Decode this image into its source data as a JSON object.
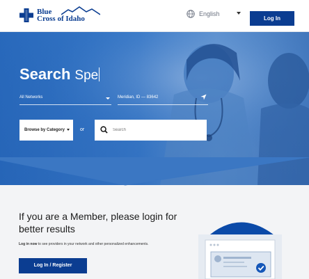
{
  "header": {
    "logo_line1": "Blue",
    "logo_line2": "Cross of Idaho",
    "language": "English",
    "login_label": "Log In"
  },
  "hero": {
    "title": "Search",
    "typed_text": "Spe",
    "network_select": "All Networks",
    "location_value": "Meridian, ID — 83642",
    "browse_label": "Browse by Category",
    "or_label": "or",
    "search_placeholder": "Search"
  },
  "member": {
    "title": "If you are a Member, please login for better results",
    "desc_bold": "Log in now",
    "desc_rest": " to see providers in your network and other personalized enhancements.",
    "register_label": "Log In / Register"
  },
  "colors": {
    "brand": "#0b3d91",
    "hero_blue": "#3d80cf",
    "page_bg": "#f3f4f6"
  },
  "icons": [
    "logo-cross-icon",
    "mountain-icon",
    "globe-icon",
    "location-arrow-icon",
    "search-icon",
    "checkmark-icon"
  ]
}
